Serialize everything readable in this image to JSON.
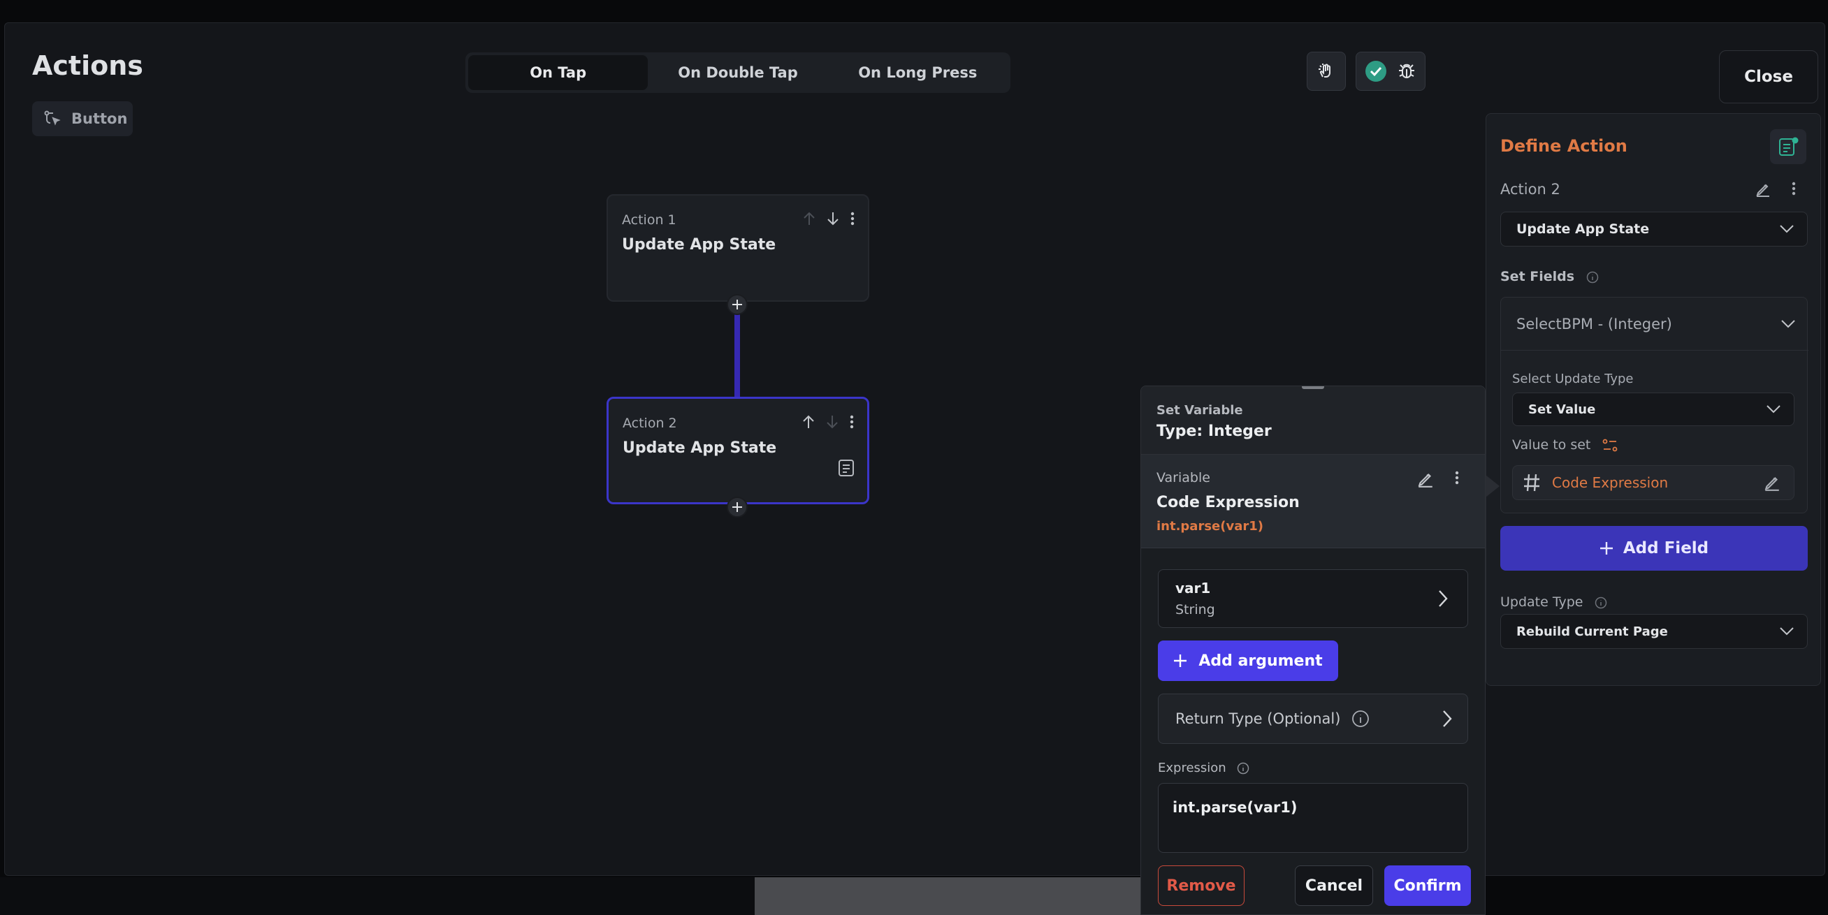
{
  "header": {
    "title": "Actions",
    "chip_label": "Button",
    "close_label": "Close"
  },
  "tabs": [
    {
      "label": "On Tap",
      "active": true
    },
    {
      "label": "On Double Tap",
      "active": false
    },
    {
      "label": "On Long Press",
      "active": false
    }
  ],
  "actions": [
    {
      "label": "Action 1",
      "title": "Update App State"
    },
    {
      "label": "Action 2",
      "title": "Update App State"
    }
  ],
  "define_action": {
    "title": "Define Action",
    "action_name": "Action 2",
    "action_type": "Update App State",
    "set_fields_label": "Set Fields",
    "field_select": "SelectBPM - (Integer)",
    "update_type_label_inner": "Select Update Type",
    "update_type_value": "Set Value",
    "value_to_set_label": "Value to set",
    "value_to_set": "Code Expression",
    "add_field_label": "Add Field",
    "update_type_label": "Update Type",
    "update_type_select": "Rebuild Current Page"
  },
  "popup": {
    "set_variable_label": "Set Variable",
    "type_label": "Type: Integer",
    "variable_label": "Variable",
    "variable_value": "Code Expression",
    "variable_expr": "int.parse(var1)",
    "arg_name": "var1",
    "arg_type": "String",
    "add_argument_label": "Add argument",
    "return_type_label": "Return Type (Optional)",
    "expression_label": "Expression",
    "expression_value": "int.parse(var1)",
    "remove_label": "Remove",
    "cancel_label": "Cancel",
    "confirm_label": "Confirm"
  },
  "colors": {
    "accent_purple": "#4a3de8",
    "accent_orange": "#e07a45",
    "danger_red": "#e25a48",
    "success_green": "#2e9c84"
  }
}
